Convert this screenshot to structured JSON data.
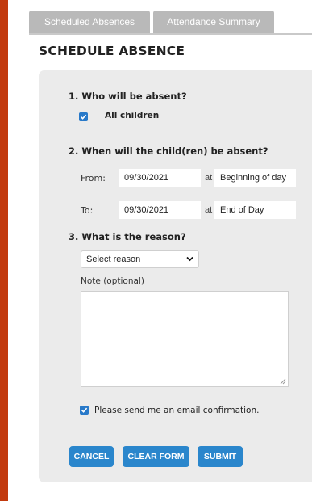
{
  "tabs": [
    {
      "label": "Scheduled Absences"
    },
    {
      "label": "Attendance Summary"
    }
  ],
  "page_title": "SCHEDULE ABSENCE",
  "q1": {
    "heading": "1. Who will be absent?",
    "all_children_label": "All children",
    "all_children_checked": true
  },
  "q2": {
    "heading": "2. When will the child(ren) be absent?",
    "from_label": "From:",
    "from_date": "09/30/2021",
    "from_at": "at",
    "from_time": "Beginning of day",
    "to_label": "To:",
    "to_date": "09/30/2021",
    "to_at": "at",
    "to_time": "End of Day"
  },
  "q3": {
    "heading": "3. What is the reason?",
    "reason_selected": "Select reason",
    "note_label": "Note (optional)",
    "note_value": ""
  },
  "email_confirm": {
    "label": "Please send me an email confirmation.",
    "checked": true
  },
  "buttons": {
    "cancel": "CANCEL",
    "clear": "CLEAR FORM",
    "submit": "SUBMIT"
  },
  "colors": {
    "outer_border": "#c23a0e",
    "accent": "#2a86cc",
    "panel": "#ebebeb",
    "tab": "#b9b9b9"
  }
}
